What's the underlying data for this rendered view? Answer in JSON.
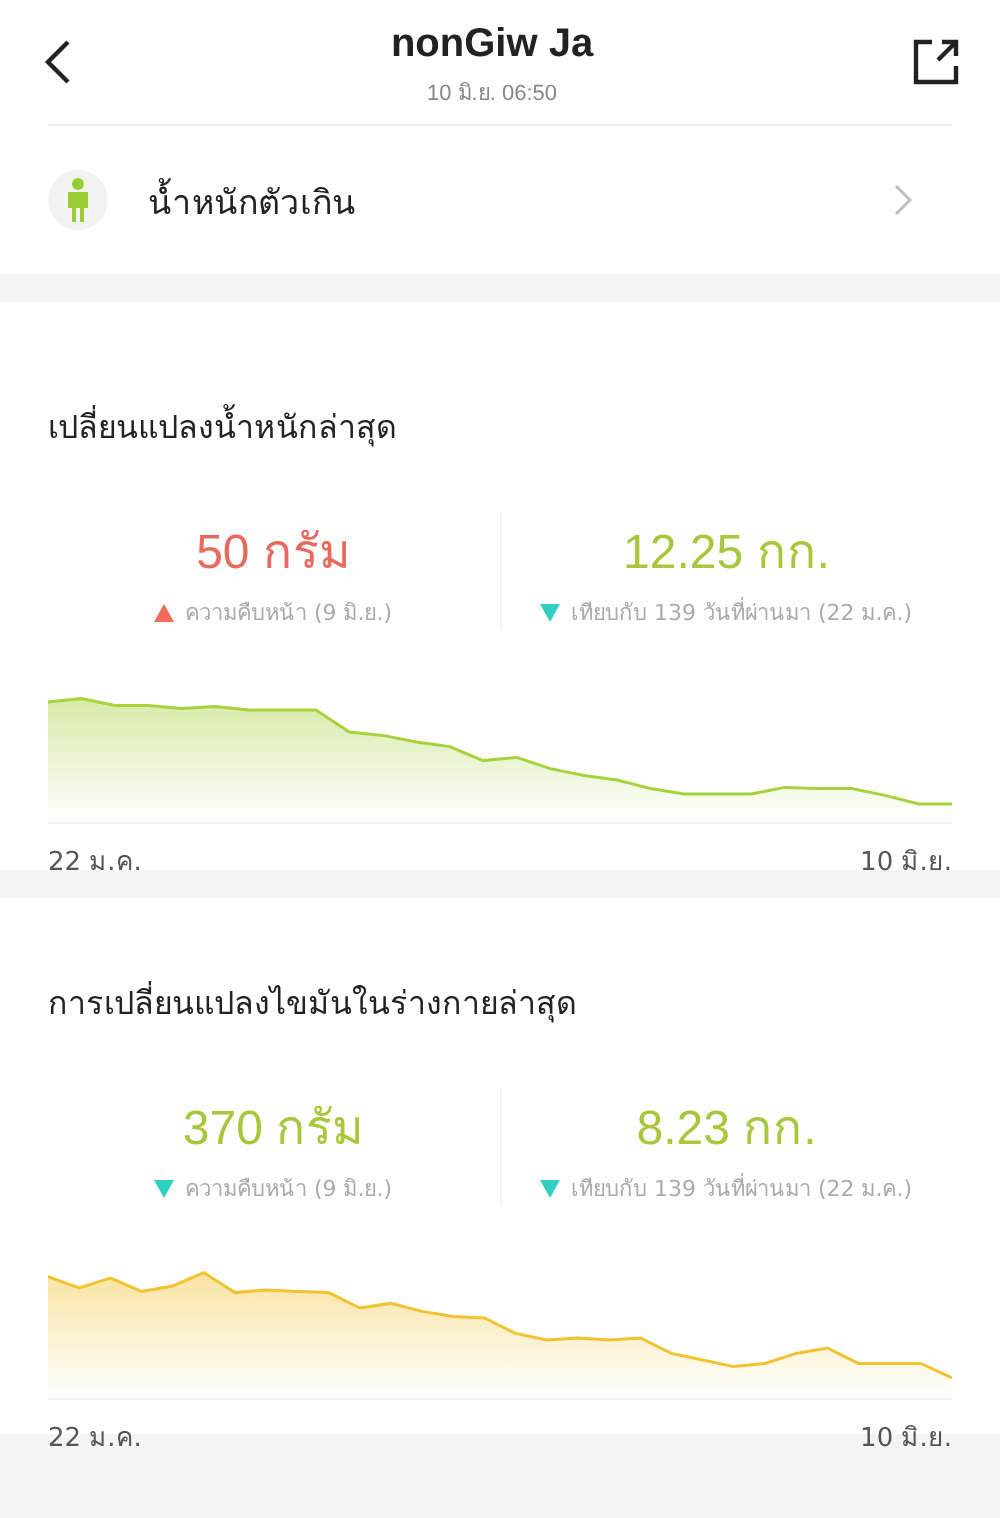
{
  "header": {
    "title": "nonGiw Ja",
    "subtitle": "10 มิ.ย. 06:50"
  },
  "status_row": {
    "label": "น้ำหนักตัวเกิน"
  },
  "sections": [
    {
      "title": "เปลี่ยนแปลงน้ำหนักล่าสุด",
      "color": "#a6d23c",
      "stats": [
        {
          "value": "50 กรัม",
          "rising": true,
          "caption": "ความคืบหน้า (9 มิ.ย.)"
        },
        {
          "value": "12.25 กก.",
          "rising": false,
          "caption": "เทียบกับ 139 วันที่ผ่านมา (22 ม.ค.)"
        }
      ],
      "start_label": "22 ม.ค.",
      "end_label": "10 มิ.ย."
    },
    {
      "title": "การเปลี่ยนแปลงไขมันในร่างกายล่าสุด",
      "color": "#f2c230",
      "stats": [
        {
          "value": "370 กรัม",
          "rising": false,
          "caption": "ความคืบหน้า (9 มิ.ย.)"
        },
        {
          "value": "8.23 กก.",
          "rising": false,
          "caption": "เทียบกับ 139 วันที่ผ่านมา (22 ม.ค.)"
        }
      ],
      "start_label": "22 ม.ค.",
      "end_label": "10 มิ.ย."
    }
  ]
}
